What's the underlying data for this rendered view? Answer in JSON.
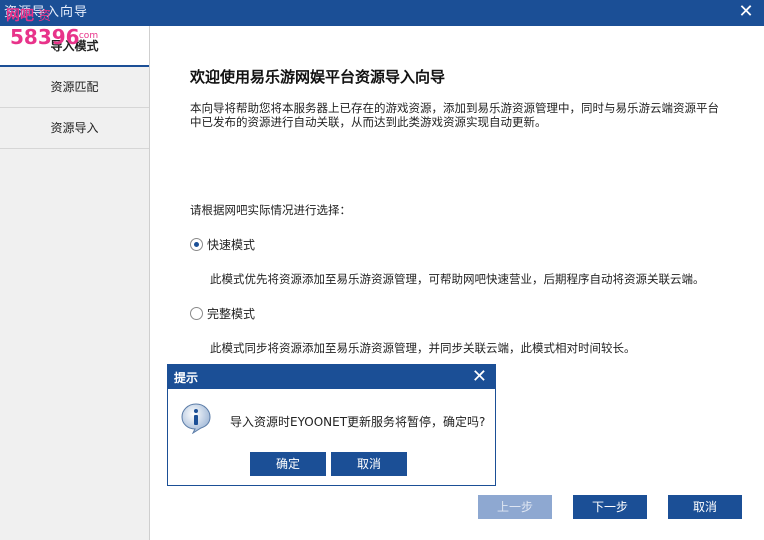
{
  "window": {
    "title": "资源导入向导"
  },
  "watermark": {
    "top": "网吧",
    "sub": "资",
    "numbers": "58396",
    "domain": ".com"
  },
  "sidebar": {
    "items": [
      {
        "label": "导入模式",
        "active": true
      },
      {
        "label": "资源匹配",
        "active": false
      },
      {
        "label": "资源导入",
        "active": false
      }
    ]
  },
  "main": {
    "heading": "欢迎使用易乐游网娱平台资源导入向导",
    "description": "本向导将帮助您将本服务器上已存在的游戏资源，添加到易乐游资源管理中，同时与易乐游云端资源平台中已发布的资源进行自动关联，从而达到此类游戏资源实现自动更新。",
    "prompt": "请根据网吧实际情况进行选择：",
    "options": [
      {
        "label": "快速模式",
        "checked": true,
        "desc": "此模式优先将资源添加至易乐游资源管理，可帮助网吧快速营业，后期程序自动将资源关联云端。"
      },
      {
        "label": "完整模式",
        "checked": false,
        "desc": "此模式同步将资源添加至易乐游资源管理，并同步关联云端，此模式相对时间较长。"
      }
    ]
  },
  "footer": {
    "prev": "上一步",
    "next": "下一步",
    "cancel": "取消"
  },
  "dialog": {
    "title": "提示",
    "message": "导入资源时EYOONET更新服务将暂停，确定吗?",
    "ok": "确定",
    "cancel": "取消"
  }
}
